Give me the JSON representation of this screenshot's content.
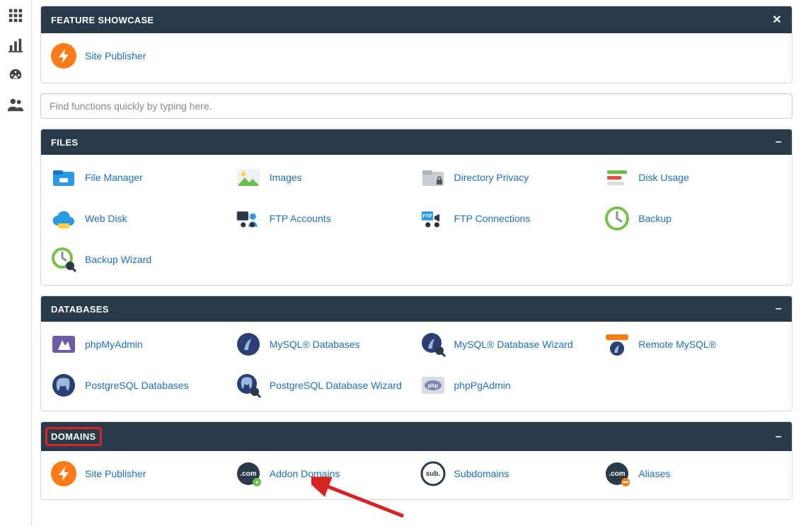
{
  "sidebar": {
    "items": [
      {
        "name": "apps-grid-icon"
      },
      {
        "name": "stats-icon"
      },
      {
        "name": "dashboard-gauge-icon"
      },
      {
        "name": "users-icon"
      }
    ]
  },
  "search": {
    "placeholder": "Find functions quickly by typing here."
  },
  "sections": {
    "feature": {
      "title": "FEATURE SHOWCASE",
      "close": "✕",
      "items": [
        {
          "label": "Site Publisher",
          "icon": "site-publisher-icon"
        }
      ]
    },
    "files": {
      "title": "FILES",
      "toggle": "–",
      "items": [
        {
          "label": "File Manager",
          "icon": "file-manager-icon"
        },
        {
          "label": "Images",
          "icon": "images-icon"
        },
        {
          "label": "Directory Privacy",
          "icon": "directory-privacy-icon"
        },
        {
          "label": "Disk Usage",
          "icon": "disk-usage-icon"
        },
        {
          "label": "Web Disk",
          "icon": "web-disk-icon"
        },
        {
          "label": "FTP Accounts",
          "icon": "ftp-accounts-icon"
        },
        {
          "label": "FTP Connections",
          "icon": "ftp-connections-icon"
        },
        {
          "label": "Backup",
          "icon": "backup-icon"
        },
        {
          "label": "Backup Wizard",
          "icon": "backup-wizard-icon"
        }
      ]
    },
    "databases": {
      "title": "DATABASES",
      "toggle": "–",
      "items": [
        {
          "label": "phpMyAdmin",
          "icon": "phpmyadmin-icon"
        },
        {
          "label": "MySQL® Databases",
          "icon": "mysql-databases-icon"
        },
        {
          "label": "MySQL® Database Wizard",
          "icon": "mysql-wizard-icon"
        },
        {
          "label": "Remote MySQL®",
          "icon": "remote-mysql-icon"
        },
        {
          "label": "PostgreSQL Databases",
          "icon": "postgresql-icon"
        },
        {
          "label": "PostgreSQL Database Wizard",
          "icon": "postgresql-wizard-icon"
        },
        {
          "label": "phpPgAdmin",
          "icon": "phppgadmin-icon"
        }
      ]
    },
    "domains": {
      "title": "DOMAINS",
      "toggle": "–",
      "items": [
        {
          "label": "Site Publisher",
          "icon": "site-publisher-icon"
        },
        {
          "label": "Addon Domains",
          "icon": "addon-domains-icon"
        },
        {
          "label": "Subdomains",
          "icon": "subdomains-icon"
        },
        {
          "label": "Aliases",
          "icon": "aliases-icon"
        }
      ]
    }
  }
}
